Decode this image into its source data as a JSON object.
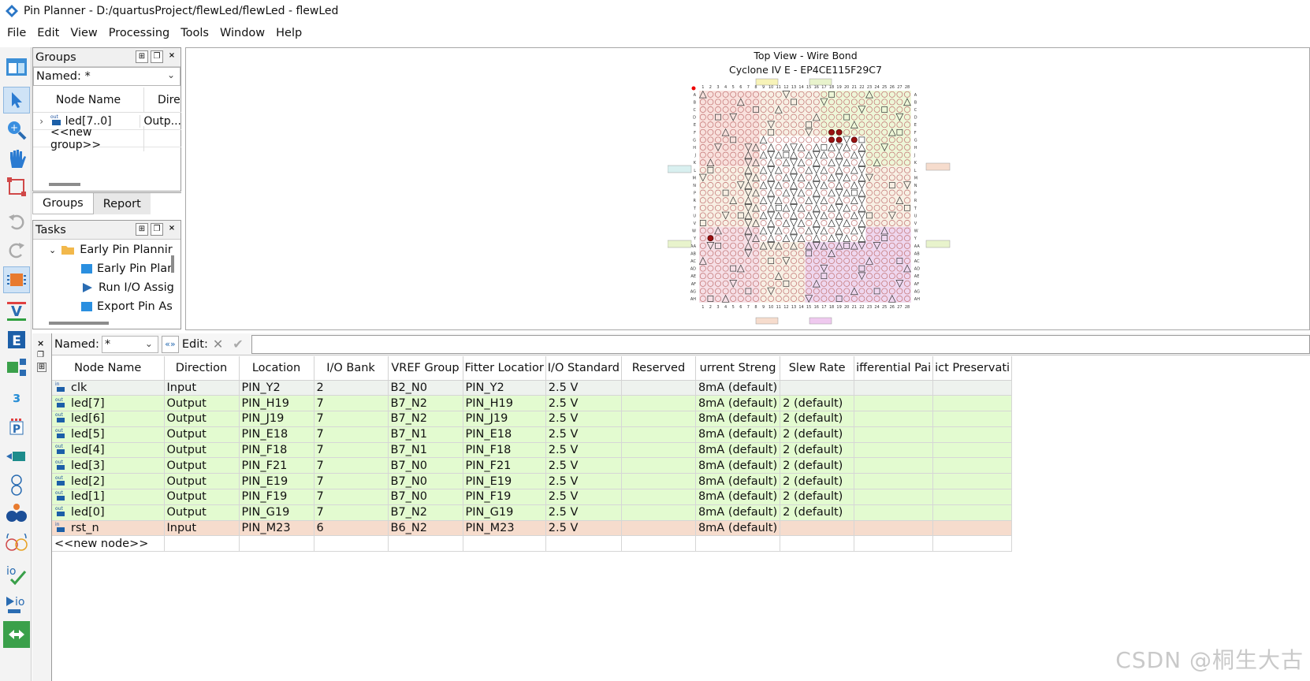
{
  "window": {
    "title": "Pin Planner - D:/quartusProject/flewLed/flewLed - flewLed"
  },
  "menu": [
    "File",
    "Edit",
    "View",
    "Processing",
    "Tools",
    "Window",
    "Help"
  ],
  "groups_panel": {
    "title": "Groups",
    "named_label": "Named: *",
    "columns": [
      "Node Name",
      "Dire"
    ],
    "rows": [
      {
        "name": "led[7..0]",
        "direction": "Outp..."
      },
      {
        "name": "<<new group>>",
        "direction": ""
      }
    ],
    "tabs": [
      "Groups",
      "Report"
    ]
  },
  "tasks_panel": {
    "title": "Tasks",
    "items": [
      "Early Pin Plannir",
      "Early Pin Plar",
      "Run I/O Assig",
      "Export Pin As"
    ]
  },
  "chip_view": {
    "title": "Top View - Wire Bond",
    "subtitle": "Cyclone IV E - EP4CE115F29C7"
  },
  "filter_bar": {
    "named_label": "Named:",
    "named_value": "*",
    "edit_label": "Edit:"
  },
  "pin_table": {
    "columns": [
      "Node Name",
      "Direction",
      "Location",
      "I/O Bank",
      "VREF Group",
      "Fitter Locatior",
      "I/O Standard",
      "Reserved",
      "urrent Streng",
      "Slew Rate",
      "ifferential Pai",
      "ict Preservati"
    ],
    "rows": [
      {
        "kind": "in",
        "row": "gray",
        "cells": [
          "clk",
          "Input",
          "PIN_Y2",
          "2",
          "B2_N0",
          "PIN_Y2",
          "2.5 V",
          "",
          "8mA (default)",
          "",
          "",
          ""
        ]
      },
      {
        "kind": "out",
        "row": "green",
        "cells": [
          "led[7]",
          "Output",
          "PIN_H19",
          "7",
          "B7_N2",
          "PIN_H19",
          "2.5 V",
          "",
          "8mA (default)",
          "2 (default)",
          "",
          ""
        ]
      },
      {
        "kind": "out",
        "row": "green",
        "cells": [
          "led[6]",
          "Output",
          "PIN_J19",
          "7",
          "B7_N2",
          "PIN_J19",
          "2.5 V",
          "",
          "8mA (default)",
          "2 (default)",
          "",
          ""
        ]
      },
      {
        "kind": "out",
        "row": "green",
        "cells": [
          "led[5]",
          "Output",
          "PIN_E18",
          "7",
          "B7_N1",
          "PIN_E18",
          "2.5 V",
          "",
          "8mA (default)",
          "2 (default)",
          "",
          ""
        ]
      },
      {
        "kind": "out",
        "row": "green",
        "cells": [
          "led[4]",
          "Output",
          "PIN_F18",
          "7",
          "B7_N1",
          "PIN_F18",
          "2.5 V",
          "",
          "8mA (default)",
          "2 (default)",
          "",
          ""
        ]
      },
      {
        "kind": "out",
        "row": "green",
        "cells": [
          "led[3]",
          "Output",
          "PIN_F21",
          "7",
          "B7_N0",
          "PIN_F21",
          "2.5 V",
          "",
          "8mA (default)",
          "2 (default)",
          "",
          ""
        ]
      },
      {
        "kind": "out",
        "row": "green",
        "cells": [
          "led[2]",
          "Output",
          "PIN_E19",
          "7",
          "B7_N0",
          "PIN_E19",
          "2.5 V",
          "",
          "8mA (default)",
          "2 (default)",
          "",
          ""
        ]
      },
      {
        "kind": "out",
        "row": "green",
        "cells": [
          "led[1]",
          "Output",
          "PIN_F19",
          "7",
          "B7_N0",
          "PIN_F19",
          "2.5 V",
          "",
          "8mA (default)",
          "2 (default)",
          "",
          ""
        ]
      },
      {
        "kind": "out",
        "row": "green",
        "cells": [
          "led[0]",
          "Output",
          "PIN_G19",
          "7",
          "B7_N2",
          "PIN_G19",
          "2.5 V",
          "",
          "8mA (default)",
          "2 (default)",
          "",
          ""
        ]
      },
      {
        "kind": "in",
        "row": "pink",
        "cells": [
          "rst_n",
          "Input",
          "PIN_M23",
          "6",
          "B6_N2",
          "PIN_M23",
          "2.5 V",
          "",
          "8mA (default)",
          "",
          "",
          ""
        ]
      }
    ],
    "new_node_label": "<<new node>>"
  },
  "watermark": "CSDN @桐生大古"
}
